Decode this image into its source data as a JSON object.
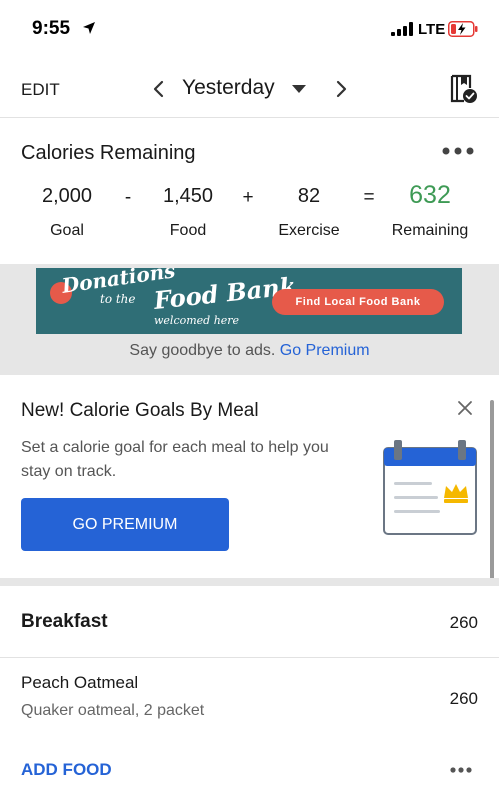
{
  "status_bar": {
    "time": "9:55",
    "network": "LTE",
    "icons": [
      "location-arrow-icon",
      "signal-icon",
      "battery-charging-icon"
    ]
  },
  "nav": {
    "edit_label": "EDIT",
    "date_label": "Yesterday",
    "icons": [
      "chevron-left-icon",
      "caret-down-icon",
      "chevron-right-icon",
      "diary-check-icon"
    ]
  },
  "calories": {
    "title": "Calories Remaining",
    "goal_value": "2,000",
    "goal_label": "Goal",
    "minus": "-",
    "food_value": "1,450",
    "food_label": "Food",
    "plus": "+",
    "exercise_value": "82",
    "exercise_label": "Exercise",
    "equals": "=",
    "remaining_value": "632",
    "remaining_label": "Remaining",
    "remaining_color": "#3e9a55"
  },
  "ad": {
    "line1": "Donations",
    "line2": "to the",
    "line3": "Food Bank",
    "line4": "welcomed here",
    "cta": "Find Local Food Bank",
    "footer_text": "Say goodbye to ads.",
    "footer_link": "Go Premium",
    "banner_color": "#2f6e76",
    "cta_color": "#e65a4a"
  },
  "promo": {
    "title": "New! Calorie Goals By Meal",
    "description": "Set a calorie goal for each meal to help you stay on track.",
    "button_label": "GO PREMIUM",
    "button_color": "#2563d6",
    "illustration_icon": "calendar-crown-icon"
  },
  "meal": {
    "name": "Breakfast",
    "calories": "260",
    "items": [
      {
        "name": "Peach Oatmeal",
        "detail": "Quaker oatmeal, 2 packet",
        "calories": "260"
      }
    ],
    "add_food_label": "ADD FOOD"
  }
}
